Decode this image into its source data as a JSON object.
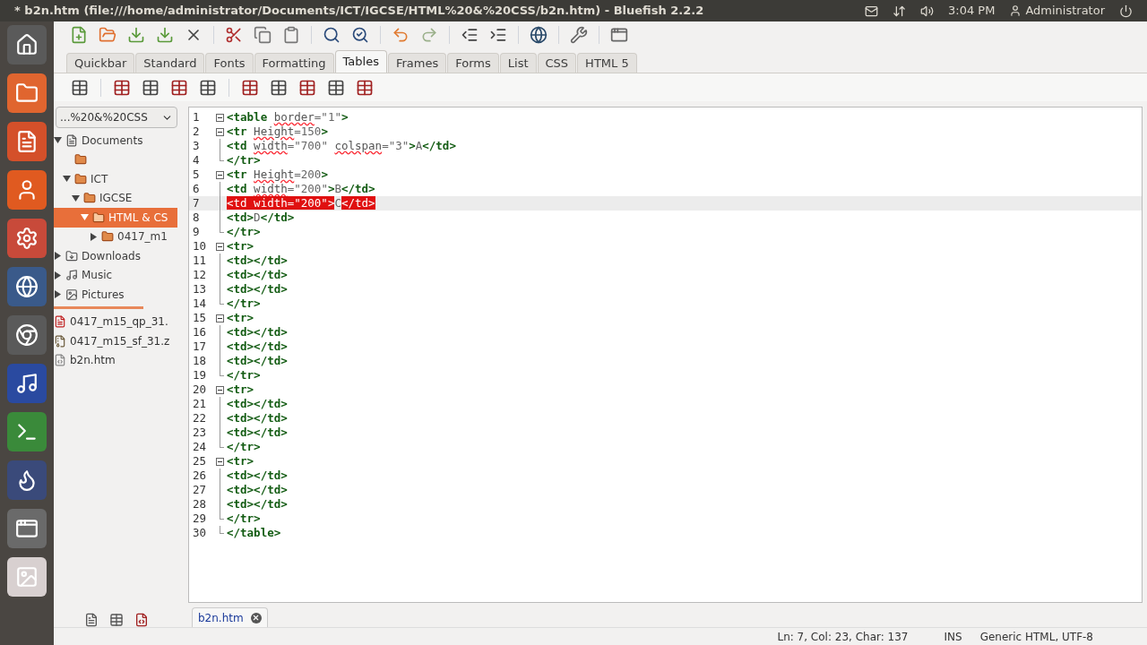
{
  "top_panel": {
    "title": "* b2n.htm (file:///home/administrator/Documents/ICT/IGCSE/HTML%20&%20CSS/b2n.htm) - Bluefish 2.2.2",
    "clock": "3:04 PM",
    "user": "Administrator"
  },
  "tabs": [
    {
      "label": "Quickbar",
      "selected": false
    },
    {
      "label": "Standard",
      "selected": false
    },
    {
      "label": "Fonts",
      "selected": false
    },
    {
      "label": "Formatting",
      "selected": false
    },
    {
      "label": "Tables",
      "selected": true
    },
    {
      "label": "Frames",
      "selected": false
    },
    {
      "label": "Forms",
      "selected": false
    },
    {
      "label": "List",
      "selected": false
    },
    {
      "label": "CSS",
      "selected": false
    },
    {
      "label": "HTML 5",
      "selected": false
    }
  ],
  "sidebar": {
    "location": "...%20&%20CSS",
    "tree": [
      {
        "kind": "documents",
        "label": "Documents",
        "expanded": true,
        "selected": false,
        "children": [
          {
            "kind": "folder"
          },
          {
            "kind": "folder",
            "label": "ICT",
            "expanded": true,
            "selected": false,
            "children": [
              {
                "kind": "folder",
                "label": "IGCSE",
                "expanded": true,
                "selected": false,
                "children": [
                  {
                    "kind": "folder",
                    "label": "HTML & CS",
                    "expanded": true,
                    "selected": true,
                    "children": [
                      {
                        "kind": "folder",
                        "label": "0417_m1",
                        "expanded": false,
                        "selected": false
                      }
                    ]
                  }
                ]
              }
            ]
          }
        ]
      },
      {
        "kind": "downloads",
        "label": "Downloads",
        "expanded": false,
        "selected": false
      },
      {
        "kind": "music",
        "label": "Music",
        "expanded": false,
        "selected": false
      },
      {
        "kind": "pictures",
        "label": "Pictures",
        "expanded": false,
        "selected": false
      }
    ],
    "files": [
      {
        "label": "0417_m15_qp_31.",
        "kind": "pdf"
      },
      {
        "label": "0417_m15_sf_31.z",
        "kind": "zip"
      },
      {
        "label": "b2n.htm",
        "kind": "html"
      }
    ]
  },
  "editor": {
    "lines": [
      {
        "number": "1",
        "kind": "open",
        "current": false,
        "segments": [
          {
            "kind": "tag",
            "text": "<table"
          },
          {
            "kind": "attr",
            "text": "border"
          },
          {
            "kind": "value",
            "text": "=\"1\""
          },
          {
            "kind": "tag",
            "text": ">"
          }
        ]
      },
      {
        "number": "2",
        "kind": "open",
        "current": false,
        "segments": [
          {
            "kind": "tag",
            "text": "<tr"
          },
          {
            "kind": "attr",
            "text": "Height"
          },
          {
            "kind": "value",
            "text": "=150"
          },
          {
            "kind": "tag",
            "text": ">"
          }
        ]
      },
      {
        "number": "3",
        "kind": "line",
        "current": false,
        "segments": [
          {
            "kind": "tag",
            "text": "<td"
          },
          {
            "kind": "attr",
            "text": "width"
          },
          {
            "kind": "value",
            "text": "=\"700\""
          },
          {
            "kind": "attr",
            "text": "colspan"
          },
          {
            "kind": "value",
            "text": "=\"3\""
          },
          {
            "kind": "tag",
            "text": ">"
          },
          {
            "kind": "text",
            "text": "A"
          },
          {
            "kind": "tag",
            "text": "</td>"
          }
        ]
      },
      {
        "number": "4",
        "kind": "end",
        "current": false,
        "segments": [
          {
            "kind": "tag",
            "text": "</tr>"
          }
        ]
      },
      {
        "number": "5",
        "kind": "open",
        "current": false,
        "segments": [
          {
            "kind": "tag",
            "text": "<tr"
          },
          {
            "kind": "attr",
            "text": "Height"
          },
          {
            "kind": "value",
            "text": "=200"
          },
          {
            "kind": "tag",
            "text": ">"
          }
        ]
      },
      {
        "number": "6",
        "kind": "line",
        "current": false,
        "segments": [
          {
            "kind": "tag",
            "text": "<td"
          },
          {
            "kind": "attr",
            "text": "width"
          },
          {
            "kind": "value",
            "text": "=\"200\""
          },
          {
            "kind": "tag",
            "text": ">"
          },
          {
            "kind": "text",
            "text": "B"
          },
          {
            "kind": "tag",
            "text": "</td>"
          }
        ]
      },
      {
        "number": "7",
        "kind": "line",
        "current": true,
        "segments": [
          {
            "kind": "match",
            "text": "<td width=\"200\">"
          },
          {
            "kind": "text",
            "text": "C"
          },
          {
            "kind": "match",
            "text": "</td>"
          }
        ]
      },
      {
        "number": "8",
        "kind": "line",
        "current": false,
        "segments": [
          {
            "kind": "tag",
            "text": "<td>"
          },
          {
            "kind": "text",
            "text": "D"
          },
          {
            "kind": "tag",
            "text": "</td>"
          }
        ]
      },
      {
        "number": "9",
        "kind": "end",
        "current": false,
        "segments": [
          {
            "kind": "tag",
            "text": "</tr>"
          }
        ]
      },
      {
        "number": "10",
        "kind": "open",
        "current": false,
        "segments": [
          {
            "kind": "tag",
            "text": "<tr>"
          }
        ]
      },
      {
        "number": "11",
        "kind": "line",
        "current": false,
        "segments": [
          {
            "kind": "tag",
            "text": "<td></td>"
          }
        ]
      },
      {
        "number": "12",
        "kind": "line",
        "current": false,
        "segments": [
          {
            "kind": "tag",
            "text": "<td></td>"
          }
        ]
      },
      {
        "number": "13",
        "kind": "line",
        "current": false,
        "segments": [
          {
            "kind": "tag",
            "text": "<td></td>"
          }
        ]
      },
      {
        "number": "14",
        "kind": "end",
        "current": false,
        "segments": [
          {
            "kind": "tag",
            "text": "</tr>"
          }
        ]
      },
      {
        "number": "15",
        "kind": "open",
        "current": false,
        "segments": [
          {
            "kind": "tag",
            "text": "<tr>"
          }
        ]
      },
      {
        "number": "16",
        "kind": "line",
        "current": false,
        "segments": [
          {
            "kind": "tag",
            "text": "<td></td>"
          }
        ]
      },
      {
        "number": "17",
        "kind": "line",
        "current": false,
        "segments": [
          {
            "kind": "tag",
            "text": "<td></td>"
          }
        ]
      },
      {
        "number": "18",
        "kind": "line",
        "current": false,
        "segments": [
          {
            "kind": "tag",
            "text": "<td></td>"
          }
        ]
      },
      {
        "number": "19",
        "kind": "end",
        "current": false,
        "segments": [
          {
            "kind": "tag",
            "text": "</tr>"
          }
        ]
      },
      {
        "number": "20",
        "kind": "open",
        "current": false,
        "segments": [
          {
            "kind": "tag",
            "text": "<tr>"
          }
        ]
      },
      {
        "number": "21",
        "kind": "line",
        "current": false,
        "segments": [
          {
            "kind": "tag",
            "text": "<td></td>"
          }
        ]
      },
      {
        "number": "22",
        "kind": "line",
        "current": false,
        "segments": [
          {
            "kind": "tag",
            "text": "<td></td>"
          }
        ]
      },
      {
        "number": "23",
        "kind": "line",
        "current": false,
        "segments": [
          {
            "kind": "tag",
            "text": "<td></td>"
          }
        ]
      },
      {
        "number": "24",
        "kind": "end",
        "current": false,
        "segments": [
          {
            "kind": "tag",
            "text": "</tr>"
          }
        ]
      },
      {
        "number": "25",
        "kind": "open",
        "current": false,
        "segments": [
          {
            "kind": "tag",
            "text": "<tr>"
          }
        ]
      },
      {
        "number": "26",
        "kind": "line",
        "current": false,
        "segments": [
          {
            "kind": "tag",
            "text": "<td></td>"
          }
        ]
      },
      {
        "number": "27",
        "kind": "line",
        "current": false,
        "segments": [
          {
            "kind": "tag",
            "text": "<td></td>"
          }
        ]
      },
      {
        "number": "28",
        "kind": "line",
        "current": false,
        "segments": [
          {
            "kind": "tag",
            "text": "<td></td>"
          }
        ]
      },
      {
        "number": "29",
        "kind": "end",
        "current": false,
        "segments": [
          {
            "kind": "tag",
            "text": "</tr>"
          }
        ]
      },
      {
        "number": "30",
        "kind": "end",
        "current": false,
        "segments": [
          {
            "kind": "tag",
            "text": "</table>"
          }
        ]
      }
    ]
  },
  "document_tab": {
    "label": "b2n.htm"
  },
  "status_bar": {
    "position": "Ln: 7, Col: 23, Char: 137",
    "mode": "INS",
    "language": "Generic HTML, UTF-8"
  }
}
